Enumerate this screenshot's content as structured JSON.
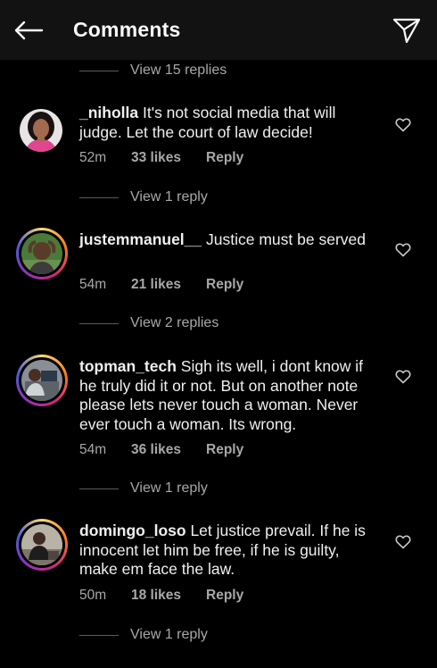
{
  "header": {
    "title": "Comments",
    "back_icon": "arrow-left-icon",
    "send_icon": "paper-plane-icon"
  },
  "top_replies": {
    "label": "View 15 replies"
  },
  "comments": [
    {
      "username": "_niholla",
      "text": "It's not social media that will judge. Let the court of law decide!",
      "time": "52m",
      "likes": "33 likes",
      "reply": "Reply",
      "replies_label": "View 1 reply"
    },
    {
      "username": "justemmanuel__",
      "text": "Justice must be served",
      "time": "54m",
      "likes": "21 likes",
      "reply": "Reply",
      "replies_label": "View 2 replies"
    },
    {
      "username": "topman_tech",
      "text": "Sigh its well, i dont know if he truly did it or not. But on another note please lets never touch a woman. Never ever touch a woman. Its wrong.",
      "time": "54m",
      "likes": "36 likes",
      "reply": "Reply",
      "replies_label": "View 1 reply"
    },
    {
      "username": "domingo_loso",
      "text": "Let justice prevail. If he is innocent let him be free, if he is guilty, make em face the law.",
      "time": "50m",
      "likes": "18 likes",
      "reply": "Reply",
      "replies_label": "View 1 reply"
    }
  ],
  "colors": {
    "background": "#000000",
    "header": "#121212",
    "secondary_text": "#a8a8a8",
    "story_ring": "#d62976"
  }
}
